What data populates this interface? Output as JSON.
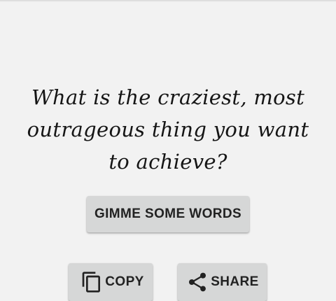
{
  "prompt": {
    "text": "What is the craziest, most outrageous thing you want to achieve?"
  },
  "actions": {
    "words_label": "GIMME SOME WORDS",
    "copy_label": "COPY",
    "share_label": "SHARE",
    "copy_icon": "copy-icon",
    "share_icon": "share-icon"
  },
  "colors": {
    "background": "#f2f2f2",
    "button": "#d6d7d7",
    "text": "#151515"
  }
}
